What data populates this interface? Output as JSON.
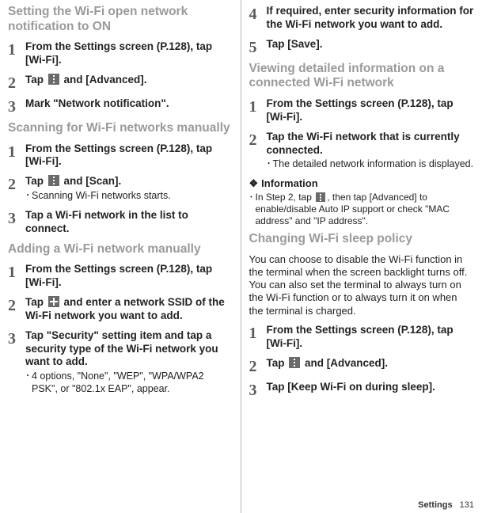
{
  "left": {
    "sections": [
      {
        "title": "Setting the Wi-Fi open network notification to ON",
        "steps": [
          {
            "num": "1",
            "label": "From the Settings screen (P.128), tap [Wi-Fi]."
          },
          {
            "num": "2",
            "label_pre": "Tap ",
            "icon": "menu",
            "label_post": " and [Advanced]."
          },
          {
            "num": "3",
            "label": "Mark \"Network notification\"."
          }
        ]
      },
      {
        "title": "Scanning for Wi-Fi networks manually",
        "steps": [
          {
            "num": "1",
            "label": "From the Settings screen (P.128), tap [Wi-Fi]."
          },
          {
            "num": "2",
            "label_pre": "Tap ",
            "icon": "menu",
            "label_post": " and [Scan].",
            "sub": "Scanning Wi-Fi networks starts."
          },
          {
            "num": "3",
            "label": "Tap a Wi-Fi network in the list to connect."
          }
        ]
      },
      {
        "title": "Adding a Wi-Fi network manually",
        "steps": [
          {
            "num": "1",
            "label": "From the Settings screen (P.128), tap [Wi-Fi]."
          },
          {
            "num": "2",
            "label_pre": "Tap ",
            "icon": "plus",
            "label_post": " and enter a network SSID of the Wi-Fi network you want to add."
          },
          {
            "num": "3",
            "label": "Tap \"Security\" setting item and tap a security type of the Wi-Fi network you want to add.",
            "sub": "4 options, \"None\", \"WEP\", \"WPA/WPA2 PSK\", or \"802.1x EAP\", appear."
          }
        ]
      }
    ]
  },
  "right": {
    "top_steps": [
      {
        "num": "4",
        "label": "If required, enter security information for the Wi-Fi network you want to add."
      },
      {
        "num": "5",
        "label": "Tap [Save]."
      }
    ],
    "sections": [
      {
        "title": "Viewing detailed information on a connected Wi-Fi network",
        "steps": [
          {
            "num": "1",
            "label": "From the Settings screen (P.128), tap [Wi-Fi]."
          },
          {
            "num": "2",
            "label": "Tap the Wi-Fi network that is currently connected.",
            "sub": "The detailed network information is displayed."
          }
        ],
        "info_heading": "Information",
        "info_item_pre": "In Step 2, tap ",
        "info_item_post": ", then tap [Advanced] to enable/disable Auto IP support or check \"MAC address\" and \"IP address\"."
      },
      {
        "title": "Changing Wi-Fi sleep policy",
        "intro": "You can choose to disable the Wi-Fi function in the terminal when the screen backlight turns off. You can also set the terminal to always turn on the Wi-Fi function or to always turn it on when the terminal is charged.",
        "steps": [
          {
            "num": "1",
            "label": "From the Settings screen (P.128), tap [Wi-Fi]."
          },
          {
            "num": "2",
            "label_pre": "Tap ",
            "icon": "menu",
            "label_post": " and [Advanced]."
          },
          {
            "num": "3",
            "label": "Tap [Keep Wi-Fi on during sleep]."
          }
        ]
      }
    ]
  },
  "footer": {
    "label": "Settings",
    "page": "131"
  },
  "bullet": "･"
}
